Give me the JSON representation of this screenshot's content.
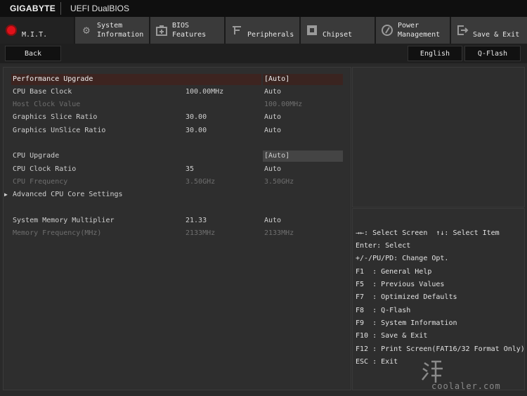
{
  "topbar": {
    "brand": "GIGABYTE",
    "product": "UEFI DualBIOS"
  },
  "tabs": [
    {
      "label": "M.I.T.",
      "icon": "mit-dot-icon",
      "active": true
    },
    {
      "label": "System\nInformation",
      "icon": "gear-icon"
    },
    {
      "label": "BIOS\nFeatures",
      "icon": "bios-features-icon"
    },
    {
      "label": "Peripherals",
      "icon": "peripherals-icon"
    },
    {
      "label": "Chipset",
      "icon": "chipset-icon"
    },
    {
      "label": "Power\nManagement",
      "icon": "power-icon"
    },
    {
      "label": "Save & Exit",
      "icon": "exit-icon"
    }
  ],
  "subbar": {
    "back": "Back",
    "language": "English",
    "qflash": "Q-Flash"
  },
  "settings": [
    {
      "label": "Performance Upgrade",
      "v1": "",
      "v2": "[Auto]"
    },
    {
      "label": "CPU Base Clock",
      "v1": "100.00MHz",
      "v2": "Auto"
    },
    {
      "label": "Host Clock Value",
      "v1": "",
      "v2": "100.00MHz"
    },
    {
      "label": "Graphics Slice Ratio",
      "v1": "30.00",
      "v2": "Auto"
    },
    {
      "label": "Graphics UnSlice Ratio",
      "v1": "30.00",
      "v2": "Auto"
    },
    {
      "label": "CPU Upgrade",
      "v1": "",
      "v2": "[Auto]"
    },
    {
      "label": "CPU Clock Ratio",
      "v1": "35",
      "v2": "Auto"
    },
    {
      "label": "CPU Frequency",
      "v1": "3.50GHz",
      "v2": "3.50GHz"
    },
    {
      "label": "Advanced CPU Core Settings",
      "v1": "",
      "v2": ""
    },
    {
      "label": "System Memory Multiplier",
      "v1": "21.33",
      "v2": "Auto"
    },
    {
      "label": "Memory Frequency(MHz)",
      "v1": "2133MHz",
      "v2": "2133MHz"
    }
  ],
  "help": [
    "→←: Select Screen  ↑↓: Select Item",
    "Enter: Select",
    "+/-/PU/PD: Change Opt.",
    "F1  : General Help",
    "F5  : Previous Values",
    "F7  : Optimized Defaults",
    "F8  : Q-Flash",
    "F9  : System Information",
    "F10 : Save & Exit",
    "F12 : Print Screen(FAT16/32 Format Only)",
    "ESC : Exit"
  ],
  "watermark": "coolaler.com",
  "colors": {
    "accent": "#e0101a",
    "highlight": "#3d2420",
    "dim_text": "#6e6e6e"
  }
}
